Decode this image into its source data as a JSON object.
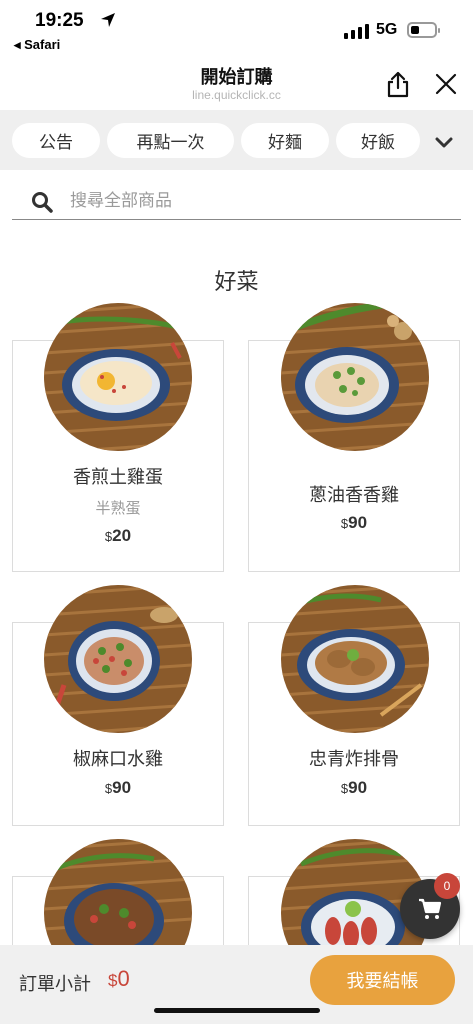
{
  "status_bar": {
    "time": "19:25",
    "back_app": "◂ Safari",
    "network": "5G"
  },
  "header": {
    "title": "開始訂購",
    "url": "line.quickclick.cc"
  },
  "tabs": [
    {
      "label": "公告"
    },
    {
      "label": "再點一次"
    },
    {
      "label": "好麵"
    },
    {
      "label": "好飯"
    }
  ],
  "search": {
    "placeholder": "搜尋全部商品"
  },
  "section": {
    "title": "好菜"
  },
  "products": [
    {
      "name": "香煎土雞蛋",
      "subtitle": "半熟蛋",
      "currency": "$",
      "price": "20"
    },
    {
      "name": "蔥油香香雞",
      "currency": "$",
      "price": "90"
    },
    {
      "name": "椒麻口水雞",
      "currency": "$",
      "price": "90"
    },
    {
      "name": "忠青炸排骨",
      "currency": "$",
      "price": "90"
    }
  ],
  "cart": {
    "count": "0"
  },
  "bottom": {
    "subtotal_label": "訂單小計",
    "currency": "$",
    "subtotal": "0",
    "checkout_label": "我要結帳"
  },
  "colors": {
    "accent": "#e8a23e",
    "price_red": "#c8463a",
    "tab_bg": "#efefef"
  },
  "icons": [
    "location-arrow-icon",
    "share-icon",
    "close-icon",
    "chevron-down-icon",
    "search-icon",
    "cart-icon"
  ]
}
